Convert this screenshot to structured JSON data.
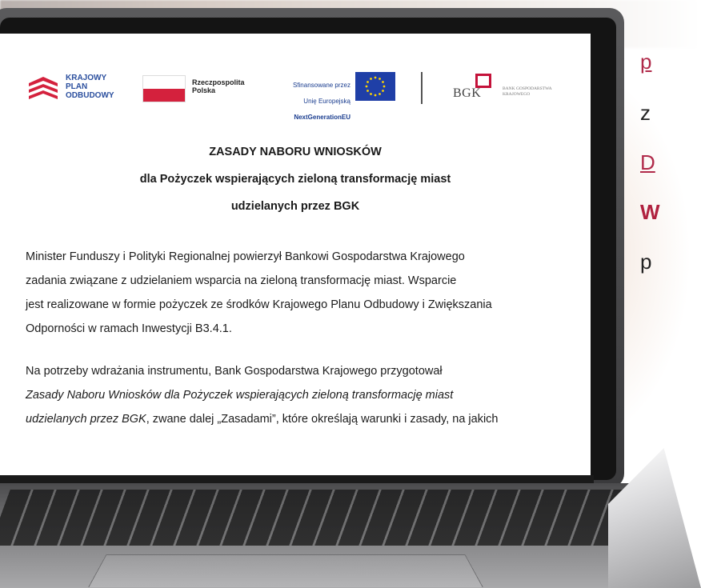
{
  "logos": {
    "kpo": "KRAJOWY\nPLAN\nODBUDOWY",
    "pl": "Rzeczpospolita\nPolska",
    "ue": [
      "Sfinansowane przez",
      "Unię Europejską",
      "NextGenerationEU"
    ],
    "bgk": "BGK",
    "bgk_sub": "BANK GOSPODARSTWA\nKRAJOWEGO"
  },
  "doc": {
    "title_1": "ZASADY NABORU WNIOSKÓW",
    "title_2": "dla Pożyczek wspierających zieloną transformację miast",
    "title_3": "udzielanych przez BGK",
    "para1": [
      "Minister Funduszy i Polityki Regionalnej powierzył Bankowi Gospodarstwa Krajowego",
      "zadania związane z udzielaniem wsparcia na zieloną transformację miast. Wsparcie",
      "jest realizowane w formie pożyczek ze środków Krajowego Planu Odbudowy i Zwiększania",
      "Odporności w ramach Inwestycji B3.4.1."
    ],
    "para2_line1": "Na potrzeby wdrażania instrumentu, Bank Gospodarstwa Krajowego przygotował",
    "para2_line2": "Zasady Naboru Wniosków dla Pożyczek wspierających zieloną transformację miast",
    "para2_line3_italic": "udzielanych przez BGK",
    "para2_line3_rest": ", zwane dalej „Zasadami”, które określają warunki i zasady, na jakich"
  },
  "right_text": [
    "p",
    "z",
    "D",
    "W",
    "p"
  ],
  "colors": {
    "accent": "#b0213f",
    "link": "#b02a4a",
    "kpo_blue": "#2b4f9e",
    "bgk_red": "#c4123a"
  }
}
